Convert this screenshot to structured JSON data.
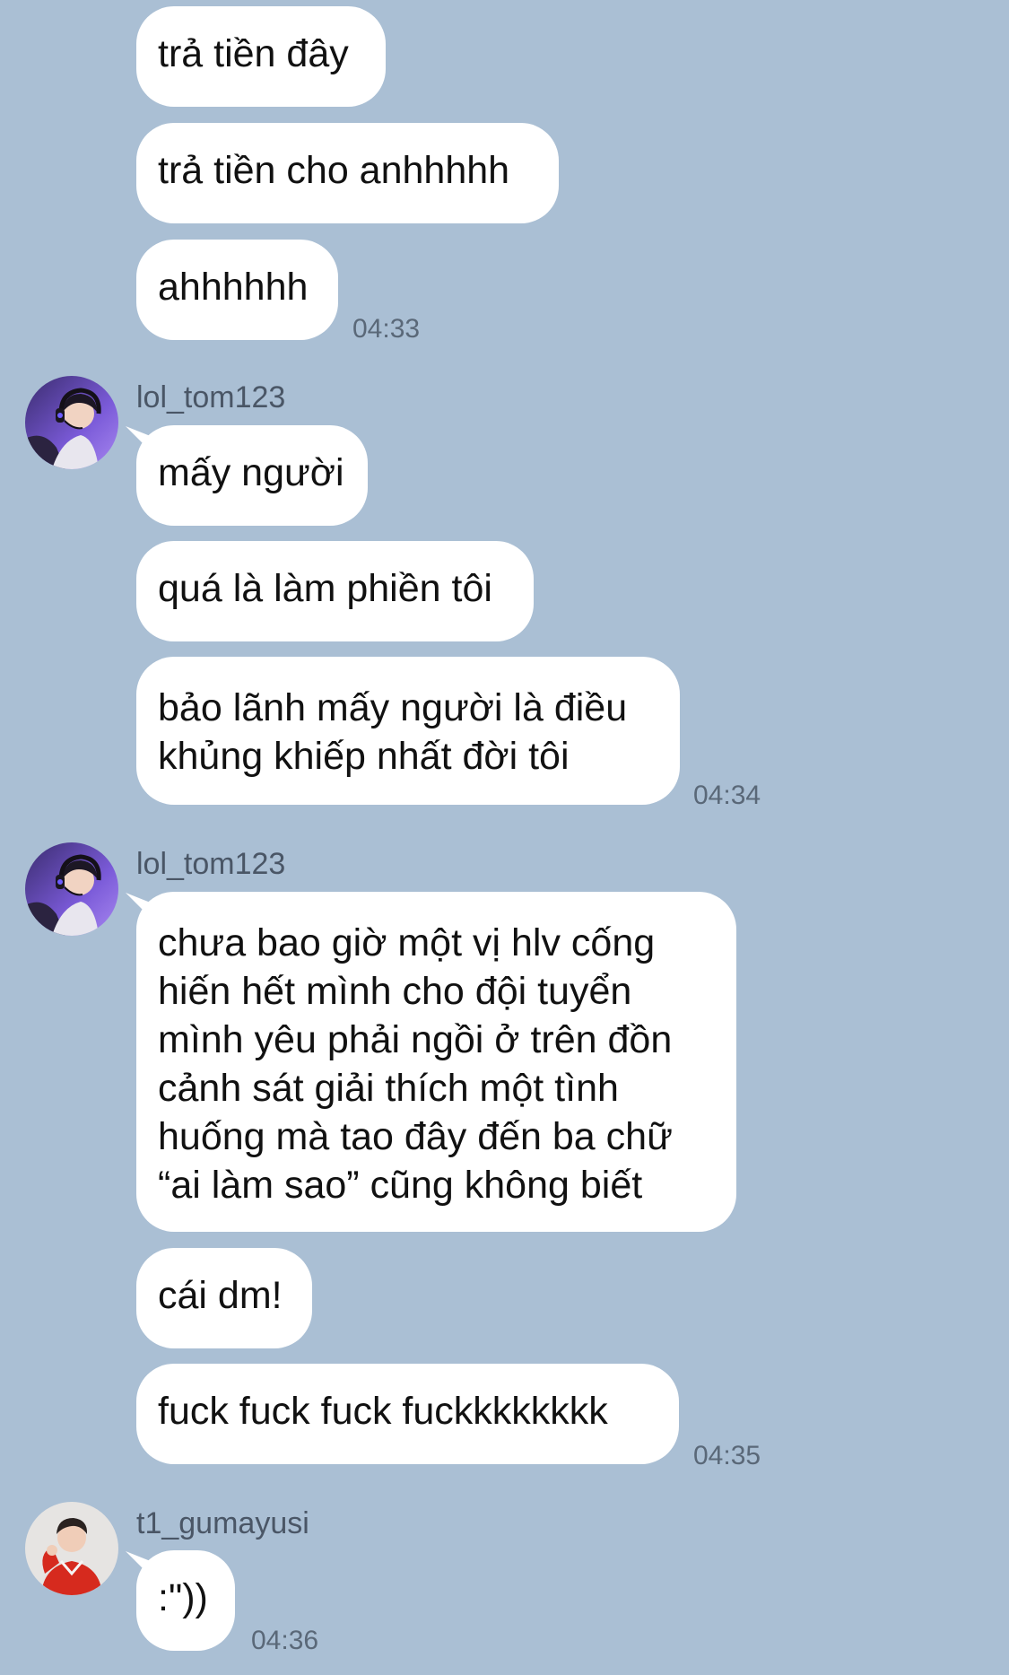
{
  "chat": {
    "group1": {
      "msg1": "trả tiền đây",
      "msg2": "trả tiền cho anhhhhh",
      "msg3": "ahhhhhh",
      "time": "04:33"
    },
    "group2": {
      "sender": "lol_tom123",
      "avatar_icon": "gamer-headset-avatar-icon",
      "msg1": "mấy người",
      "msg2": "quá là làm phiền tôi",
      "msg3": "bảo lãnh mấy người là điều\nkhủng khiếp nhất đời tôi",
      "time": "04:34"
    },
    "group3": {
      "sender": "lol_tom123",
      "avatar_icon": "gamer-headset-avatar-icon",
      "msg1": "chưa bao giờ một vị hlv cống\nhiến hết mình cho đội tuyển\nmình yêu phải ngồi ở trên đồn\ncảnh sát giải thích một tình\nhuống mà tao đây đến ba chữ\n“ai làm sao” cũng không biết",
      "msg2": "cái dm!",
      "msg3": "fuck fuck fuck fuckkkkkkkk",
      "time": "04:35"
    },
    "group4": {
      "sender": "t1_gumayusi",
      "avatar_icon": "red-jacket-person-avatar-icon",
      "msg1": ":\"))",
      "time": "04:36"
    }
  },
  "colors": {
    "background": "#aabfd4",
    "bubble": "#ffffff",
    "timestamp": "#5a6878",
    "username": "#4a5666"
  }
}
